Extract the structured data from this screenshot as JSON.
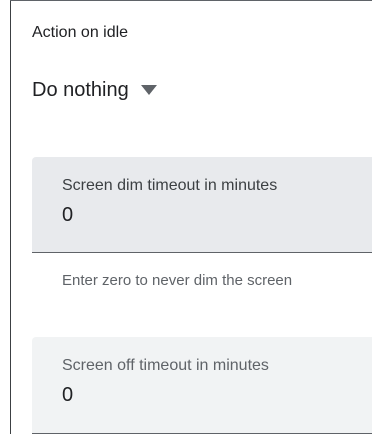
{
  "idle_action": {
    "label": "Action on idle",
    "selected": "Do nothing"
  },
  "screen_dim": {
    "label": "Screen dim timeout in minutes",
    "value": "0",
    "helper": "Enter zero to never dim the screen"
  },
  "screen_off": {
    "label": "Screen off timeout in minutes",
    "value": "0"
  },
  "icons": {
    "dropdown": "dropdown-arrow-icon"
  },
  "colors": {
    "text": "#202124",
    "secondary_text": "#5f6368",
    "field_background": "#e8eaed",
    "field_background_light": "#f1f3f4",
    "underline": "#5f6368"
  }
}
